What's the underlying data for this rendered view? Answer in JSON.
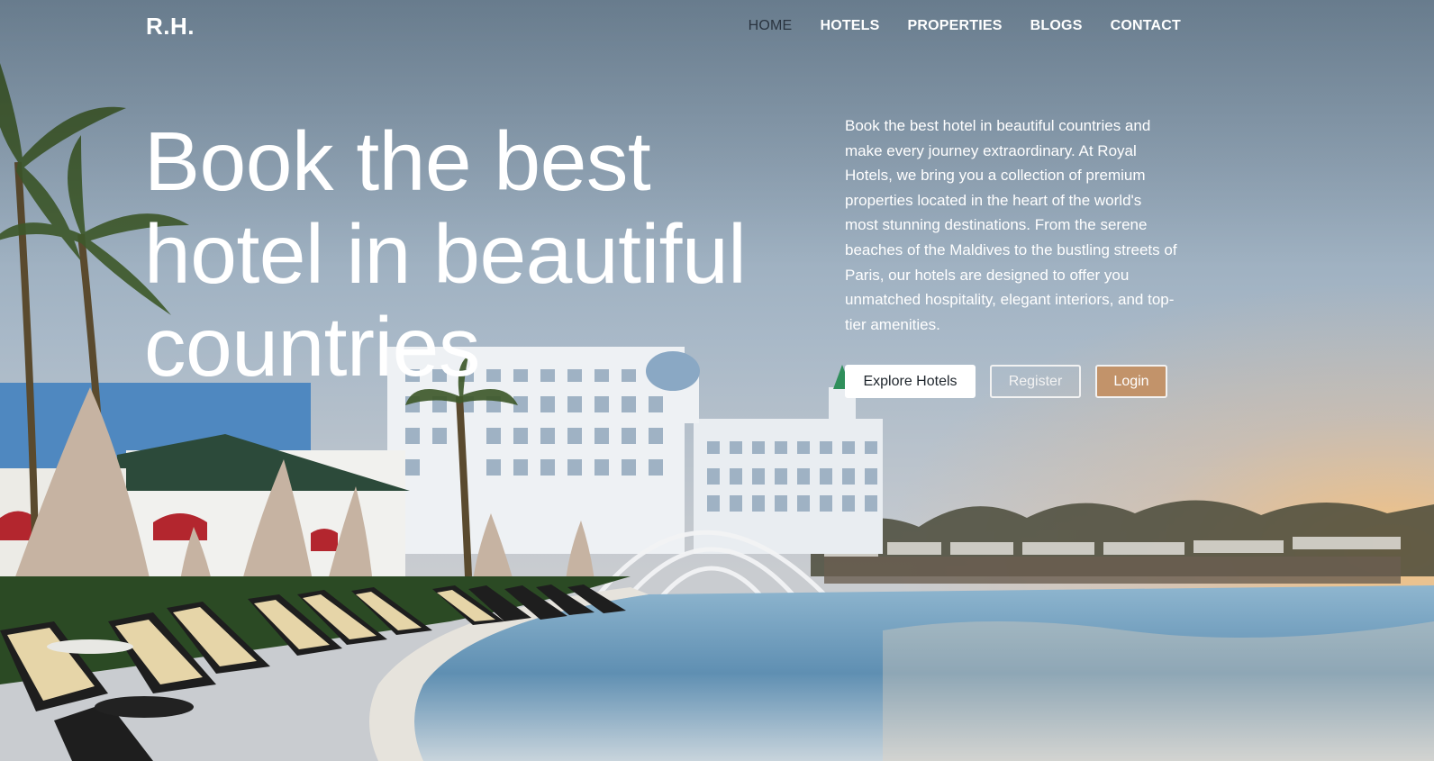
{
  "brand": {
    "logo": "R.H."
  },
  "nav": {
    "items": [
      {
        "label": "HOME",
        "active": true
      },
      {
        "label": "HOTELS",
        "active": false
      },
      {
        "label": "PROPERTIES",
        "active": false
      },
      {
        "label": "BLOGS",
        "active": false
      },
      {
        "label": "CONTACT",
        "active": false
      }
    ]
  },
  "hero": {
    "headline_lines": [
      "Book the best",
      "hotel in beautiful",
      "countries"
    ],
    "description": "Book the best hotel in beautiful countries and make every journey extraordinary. At Royal Hotels, we bring you a collection of premium properties located in the heart of the world's most stunning destinations. From the serene beaches of the Maldives to the bustling streets of Paris, our hotels are designed to offer you unmatched hospitality, elegant interiors, and top-tier amenities.",
    "buttons": {
      "explore": "Explore Hotels",
      "register": "Register",
      "login": "Login"
    }
  },
  "colors": {
    "accent": "#c2936a",
    "nav_active": "#2a3440",
    "text_light": "#ffffff"
  }
}
